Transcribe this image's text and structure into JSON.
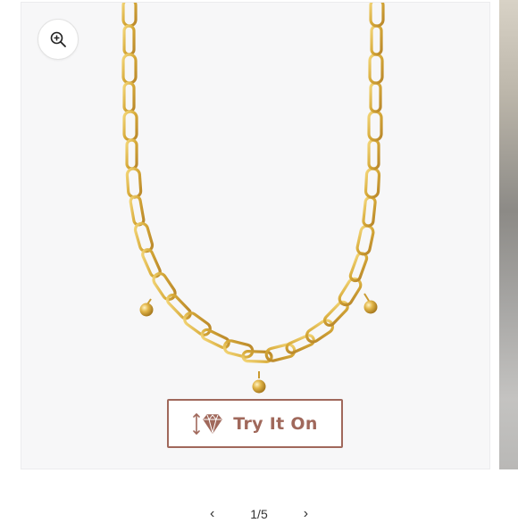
{
  "gallery": {
    "try_on_label": "Try It On",
    "pagination": "1/5",
    "prev_icon": "chevron-left-icon",
    "next_icon": "chevron-right-icon",
    "zoom_icon": "zoom-in-icon",
    "try_on_icon": "diamond-arrows-icon"
  },
  "colors": {
    "accent": "#a0685b",
    "slide_background": "#f7f7f8",
    "gold": "#d9ad3c"
  }
}
